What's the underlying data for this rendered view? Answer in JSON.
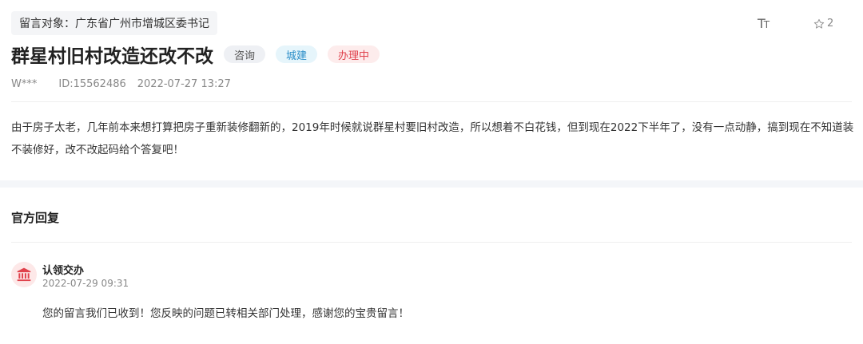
{
  "header": {
    "recipient": "留言对象：广东省广州市增城区委书记",
    "font_size_toggle": {
      "big": "T",
      "small": "T"
    },
    "star_count": "2"
  },
  "message": {
    "title": "群星村旧村改造还改不改",
    "tags": [
      {
        "label": "咨询",
        "style": "gray"
      },
      {
        "label": "城建",
        "style": "blue"
      },
      {
        "label": "办理中",
        "style": "red"
      }
    ],
    "author": "W***",
    "id": "ID:15562486",
    "time": "2022-07-27 13:27",
    "body": "由于房子太老，几年前本来想打算把房子重新装修翻新的，2019年时候就说群星村要旧村改造，所以想着不白花钱，但到现在2022下半年了，没有一点动静，搞到现在不知道装不装修好，改不改起码给个答复吧！"
  },
  "official_reply": {
    "section_title": "官方回复",
    "status": "认领交办",
    "date": "2022-07-29 09:31",
    "text": "您的留言我们已收到！您反映的问题已转相关部门处理，感谢您的宝贵留言！",
    "icon": "government-building-icon"
  },
  "colors": {
    "tag_gray_bg": "#eef0f4",
    "tag_blue": "#2b8ec8",
    "tag_red": "#e0414b",
    "icon_red": "#e0414b"
  }
}
